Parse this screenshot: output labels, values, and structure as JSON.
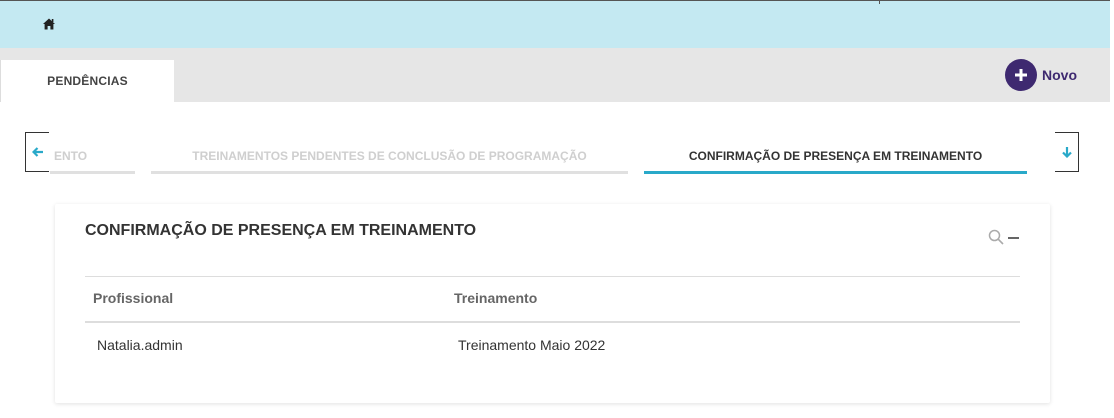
{
  "topbar": {
    "home_icon": "home-icon",
    "background": "#c4e9f2"
  },
  "tabs": {
    "active_label": "PENDÊNCIAS"
  },
  "actions": {
    "new_label": "Novo",
    "new_icon": "plus-icon",
    "accent": "#3e2970"
  },
  "wizard": {
    "prev_icon": "arrow-left-icon",
    "next_icon": "arrow-down-icon",
    "steps": [
      {
        "label": "ENTO"
      },
      {
        "label": "TREINAMENTOS PENDENTES DE CONCLUSÃO DE PROGRAMAÇÃO"
      },
      {
        "label": "CONFIRMAÇÃO DE PRESENÇA EM TREINAMENTO"
      }
    ],
    "active_color": "#29a9c9"
  },
  "card": {
    "title": "CONFIRMAÇÃO DE PRESENÇA EM TREINAMENTO",
    "search_icon": "search-icon",
    "collapse_icon": "minus-icon",
    "columns": [
      "Profissional",
      "Treinamento"
    ],
    "rows": [
      [
        "Natalia.admin",
        "Treinamento Maio 2022"
      ]
    ]
  }
}
